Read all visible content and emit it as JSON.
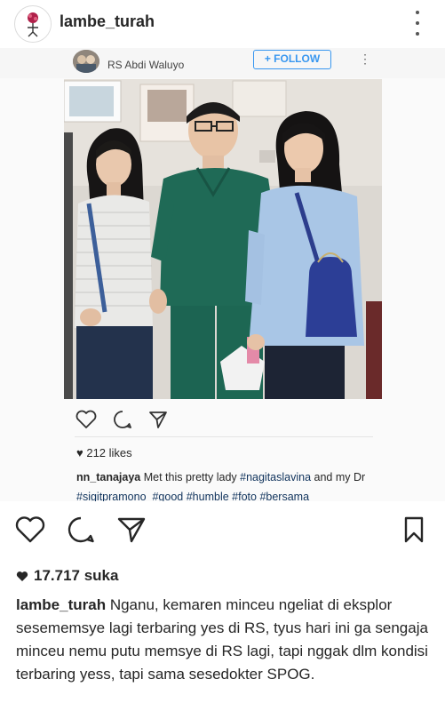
{
  "header": {
    "username": "lambe_turah",
    "more_icon": "more-vertical-icon"
  },
  "embedded_post": {
    "location": "RS Abdi Waluyo",
    "follow_label": "+ FOLLOW",
    "likes": "212 likes",
    "caption_user": "nn_tanajaya",
    "caption_text": " Met this pretty lady ",
    "caption_tag1": "#nagitaslavina",
    "caption_mid": " and my Dr ",
    "caption_tag2": "#sigitpramono",
    "caption_tag3": "#good",
    "caption_tag4": "#humble",
    "caption_tag5": "#foto",
    "caption_tag6": "#bersama"
  },
  "post": {
    "likes_count": "17.717 suka",
    "caption_user": "lambe_turah",
    "caption_text": " Nganu, kemaren minceu ngeliat di eksplor sesememsye lagi terbaring yes di RS, tyus hari ini ga sengaja minceu nemu putu memsye di RS lagi, tapi nggak dlm kondisi terbaring yess, tapi sama sesedokter SPOG."
  },
  "colors": {
    "text": "#262626",
    "link_blue": "#3897f0",
    "hashtag": "#10335c"
  }
}
